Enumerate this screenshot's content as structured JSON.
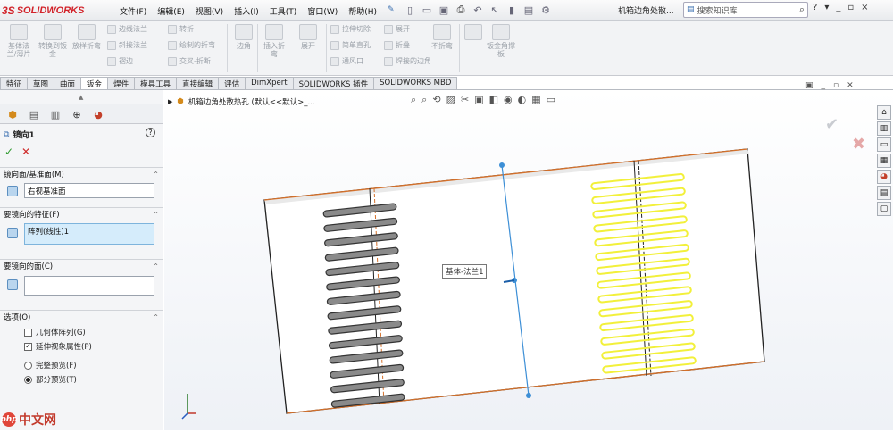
{
  "app": {
    "logo_text": "SOLIDWORKS",
    "logo_mark": "3S"
  },
  "menu": [
    "文件(F)",
    "编辑(E)",
    "视图(V)",
    "插入(I)",
    "工具(T)",
    "窗口(W)",
    "帮助(H)"
  ],
  "doc_title": "机箱边角处散...",
  "search": {
    "placeholder": "搜索知识库"
  },
  "window_controls": [
    "?",
    "-",
    "_",
    "▫",
    "×"
  ],
  "ribbon": {
    "large_buttons": [
      "基体法兰/薄片",
      "转换到钣金",
      "放样折弯",
      "边角",
      "插入折弯",
      "展开",
      "拉伸切除",
      "不折弯",
      "钣金角撑板"
    ],
    "small_buttons": [
      "边线法兰",
      "斜接法兰",
      "褶边",
      "转折",
      "绘制的折弯",
      "交叉-折断",
      "简单直孔",
      "通风口",
      "展开",
      "折叠",
      "焊接的边角"
    ]
  },
  "tabs": [
    "特征",
    "草图",
    "曲面",
    "钣金",
    "焊件",
    "模具工具",
    "直接编辑",
    "评估",
    "DimXpert",
    "SOLIDWORKS 插件",
    "SOLIDWORKS MBD"
  ],
  "active_tab": "钣金",
  "property_manager": {
    "title": "镜向1",
    "sections": {
      "mirror_face": {
        "label": "镜向面/基准面(M)",
        "value": "右视基准面"
      },
      "features": {
        "label": "要镜向的特征(F)",
        "value": "阵列(线性)1"
      },
      "faces": {
        "label": "要镜向的面(C)",
        "value": ""
      },
      "options": {
        "label": "选项(O)",
        "geometry_pattern": {
          "label": "几何体阵列(G)",
          "checked": false
        },
        "propagate": {
          "label": "延伸视象属性(P)",
          "checked": true
        },
        "full_preview": {
          "label": "完整预览(F)",
          "selected": false
        },
        "partial_preview": {
          "label": "部分预览(T)",
          "selected": true
        }
      }
    }
  },
  "viewport": {
    "tree_label": "机箱边角处散热孔 (默认<<默认>_...",
    "tooltip": "基体-法兰1"
  },
  "watermark": {
    "icon": "php",
    "text": "中文网"
  },
  "colors": {
    "accent_red": "#d2232a",
    "highlight_yellow": "#f2f03a",
    "slot_gray": "#555555",
    "edge_orange": "#d4702a",
    "plane_blue": "#3d8fd6"
  }
}
